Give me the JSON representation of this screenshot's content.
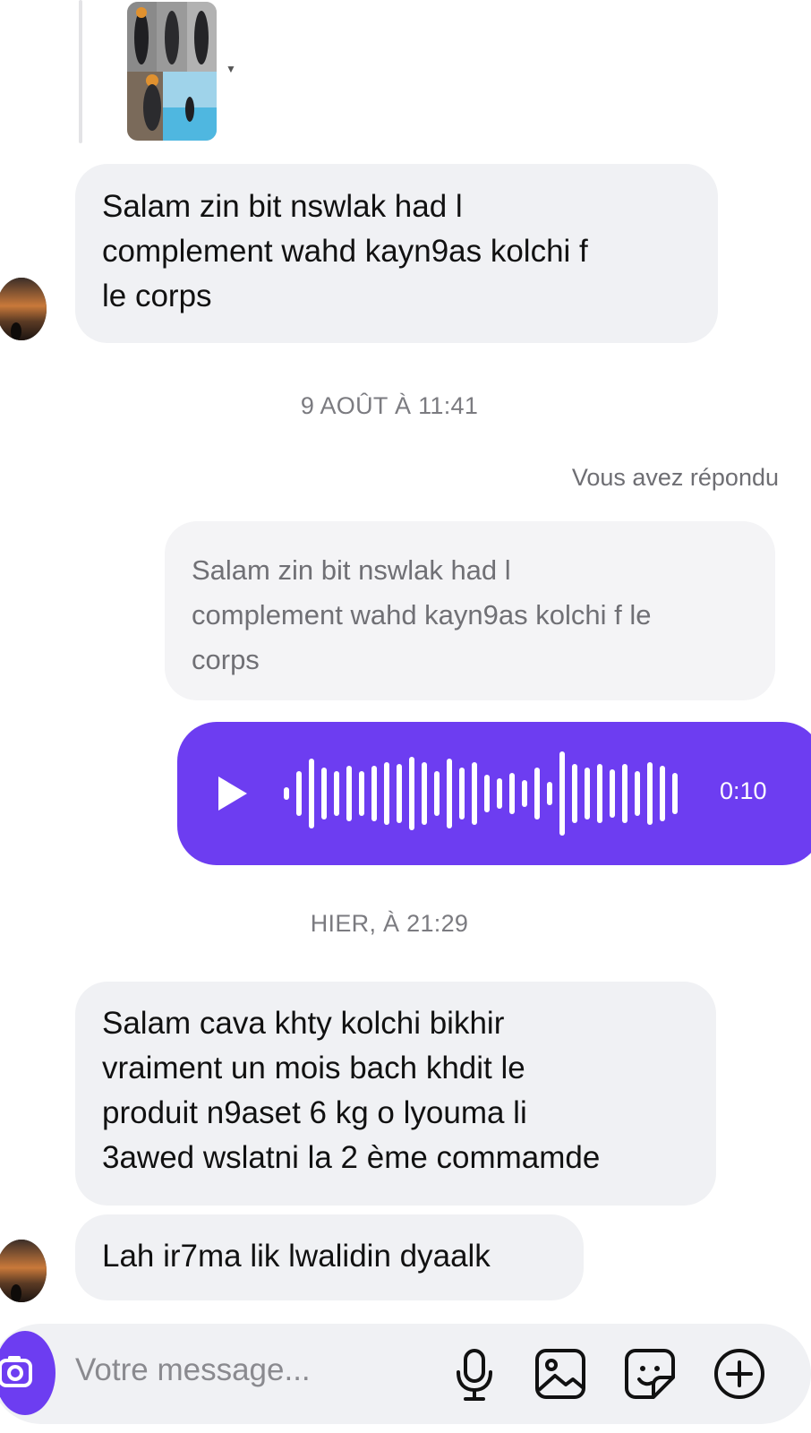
{
  "conversation": {
    "messages": [
      {
        "sender": "other",
        "text": "Salam zin bit nswlak had l\ncomplement wahd kayn9as kolchi f\nle corps"
      },
      {
        "sender": "other",
        "text": "Salam cava khty kolchi bikhir\nvraiment un mois bach khdit le\nproduit n9aset 6 kg o lyouma li\n3awed wslatni la 2 ème commamde"
      },
      {
        "sender": "other",
        "text": "Lah ir7ma lik lwalidin dyaalk"
      }
    ],
    "timestamps": [
      "9 AOÛT À 11:41",
      "HIER, À 21:29"
    ],
    "reply_label": "Vous avez répondu",
    "quoted_text": "Salam zin bit nswlak had l\ncomplement wahd kayn9as kolchi f le\ncorps",
    "voice_message": {
      "duration": "0:10"
    }
  },
  "composer": {
    "placeholder": "Votre message..."
  },
  "icons": [
    "camera-icon",
    "microphone-icon",
    "image-icon",
    "sticker-icon",
    "plus-circle-icon",
    "play-icon"
  ],
  "colors": {
    "accent": "#6d3df1",
    "bubble": "#f0f1f4",
    "meta_text": "#7b7b80"
  }
}
